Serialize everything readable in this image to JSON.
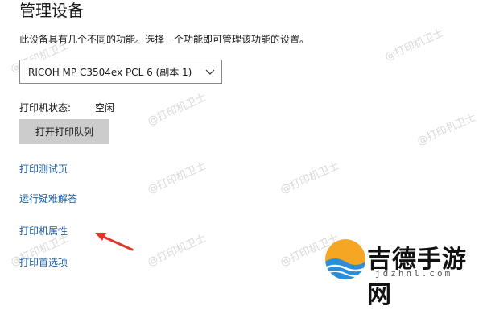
{
  "header": {
    "title": "管理设备"
  },
  "description": "此设备具有几个不同的功能。选择一个功能即可管理该功能的设置。",
  "printer_select": {
    "selected": "RICOH MP C3504ex PCL 6 (副本 1)"
  },
  "status": {
    "label": "打印机状态:",
    "value": "空闲"
  },
  "open_queue_button": {
    "label": "打开打印队列"
  },
  "links": [
    {
      "label": "打印测试页"
    },
    {
      "label": "运行疑难解答"
    },
    {
      "label": "打印机属性"
    },
    {
      "label": "打印首选项"
    }
  ],
  "watermark": {
    "text": "@打印机卫士"
  },
  "logo": {
    "name": "吉德手游网",
    "domain": "jdzhnl.com"
  },
  "colors": {
    "link": "#1a5fa8",
    "button": "#cccccc",
    "arrow": "#e0352b"
  }
}
